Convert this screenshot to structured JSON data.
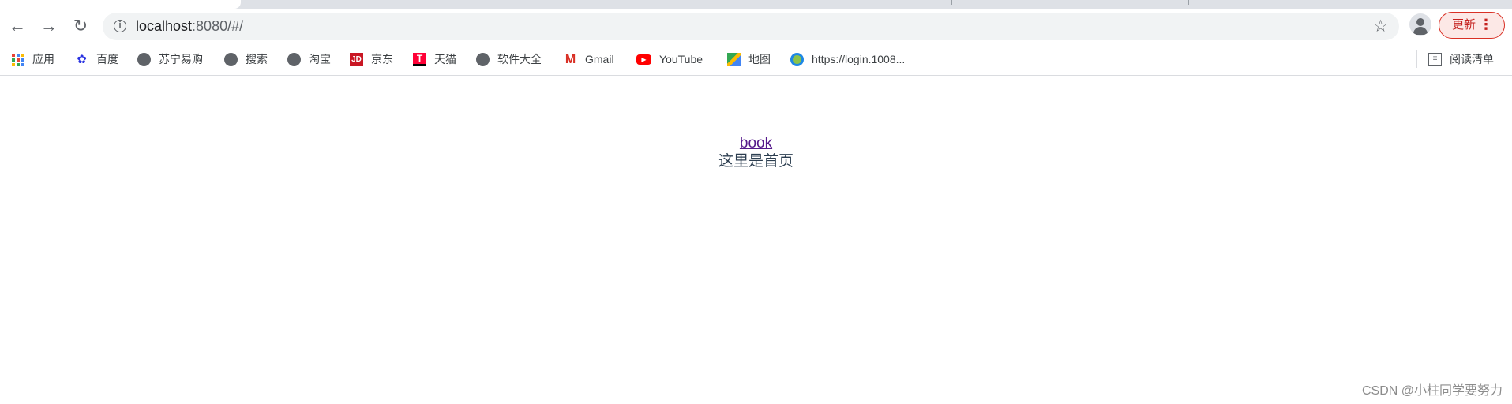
{
  "browser": {
    "url_host": "localhost",
    "url_rest": ":8080/#/",
    "update_label": "更新"
  },
  "bookmarks": [
    {
      "label": "应用",
      "icon": "apps-grid-icon"
    },
    {
      "label": "百度",
      "icon": "baidu-icon"
    },
    {
      "label": "苏宁易购",
      "icon": "globe-icon"
    },
    {
      "label": "搜索",
      "icon": "globe-icon"
    },
    {
      "label": "淘宝",
      "icon": "globe-icon"
    },
    {
      "label": "京东",
      "icon": "jd-icon"
    },
    {
      "label": "天猫",
      "icon": "tmall-icon"
    },
    {
      "label": "软件大全",
      "icon": "globe-icon"
    },
    {
      "label": "Gmail",
      "icon": "gmail-icon"
    },
    {
      "label": "YouTube",
      "icon": "youtube-icon"
    },
    {
      "label": "地图",
      "icon": "maps-icon"
    },
    {
      "label": "https://login.1008...",
      "icon": "china-mobile-icon"
    }
  ],
  "reading_list": "阅读清单",
  "page": {
    "link": "book",
    "text": "这里是首页"
  },
  "watermark": "CSDN @小柱同学要努力"
}
